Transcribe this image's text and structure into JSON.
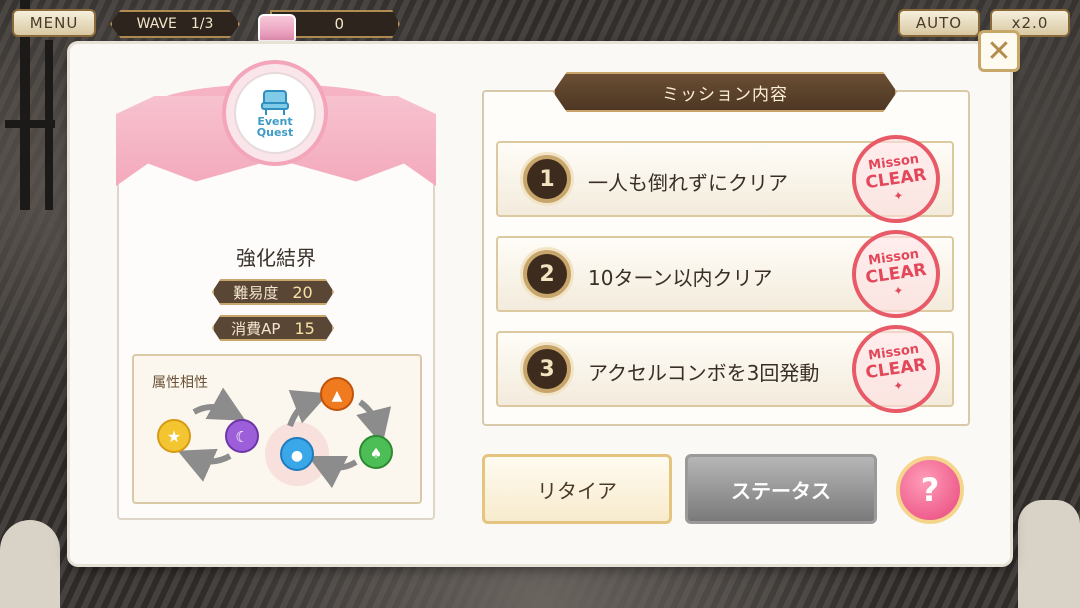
{
  "hud": {
    "menu_label": "MENU",
    "wave_label": "WAVE",
    "wave_value": "1/3",
    "treasure_count": "0",
    "auto_label": "AUTO",
    "speed_label": "x2.0"
  },
  "quest": {
    "badge_line1": "Event",
    "badge_line2": "Quest",
    "title": "強化結界",
    "difficulty_label": "難易度",
    "difficulty_value": "20",
    "ap_label": "消費AP",
    "ap_value": "15",
    "attribute_label": "属性相性",
    "attributes": [
      "light",
      "dark",
      "fire",
      "wood",
      "water"
    ]
  },
  "missions": {
    "header": "ミッション内容",
    "items": [
      {
        "num": "1",
        "text": "一人も倒れずにクリア",
        "stamp_top": "Misson",
        "stamp_main": "CLEAR"
      },
      {
        "num": "2",
        "text": "10ターン以内クリア",
        "stamp_top": "Misson",
        "stamp_main": "CLEAR"
      },
      {
        "num": "3",
        "text": "アクセルコンボを3回発動",
        "stamp_top": "Misson",
        "stamp_main": "CLEAR"
      }
    ]
  },
  "buttons": {
    "retire": "リタイア",
    "status": "ステータス",
    "help": "?",
    "close": "✕"
  },
  "colors": {
    "accent_pink": "#f3a9bb",
    "frame_gold": "#c8a469",
    "header_brown": "#5a4634",
    "stamp_red": "#e2475a"
  }
}
